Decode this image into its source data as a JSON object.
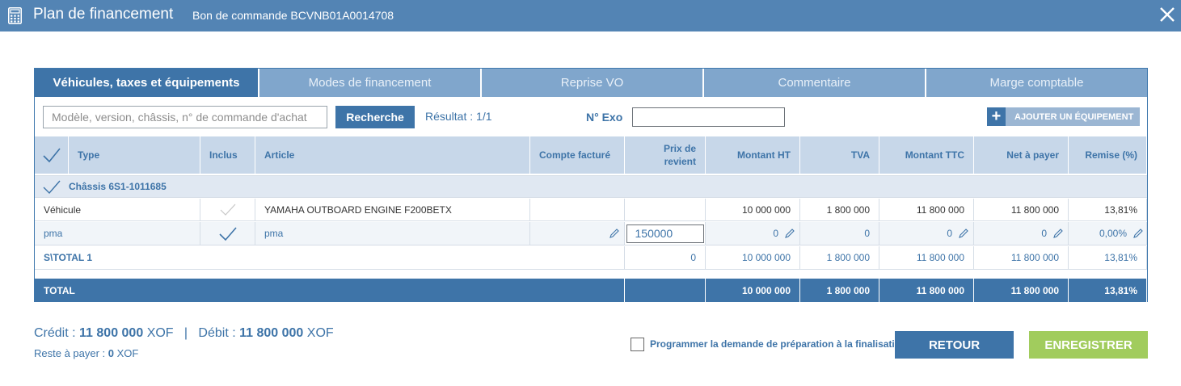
{
  "window": {
    "title": "Plan de financement",
    "subtitle": "Bon de commande BCVNB01A0014708",
    "icon": "calculator-icon",
    "close_icon": "close-icon"
  },
  "tabs": [
    {
      "label": "Véhicules, taxes et équipements",
      "active": true
    },
    {
      "label": "Modes de financement",
      "active": false
    },
    {
      "label": "Reprise VO",
      "active": false
    },
    {
      "label": "Commentaire",
      "active": false
    },
    {
      "label": "Marge comptable",
      "active": false
    }
  ],
  "toolbar": {
    "search_placeholder": "Modèle, version, châssis, n° de commande d'achat",
    "search_value": "",
    "search_button": "Recherche",
    "result_text": "Résultat : 1/1",
    "exo_label": "N° Exo",
    "exo_value": "",
    "add_button": "AJOUTER UN ÉQUIPEMENT",
    "add_icon": "plus-icon"
  },
  "table": {
    "headers": {
      "type": "Type",
      "inclus": "Inclus",
      "article": "Article",
      "compte": "Compte facturé",
      "prix_line1": "Prix de",
      "prix_line2": "revient",
      "ht": "Montant HT",
      "tva": "TVA",
      "ttc": "Montant TTC",
      "net": "Net à payer",
      "remise": "Remise (%)"
    },
    "chassis_label": "Châssis 6S1-1011685",
    "rows": [
      {
        "type": "Véhicule",
        "article": "YAMAHA OUTBOARD ENGINE F200BETX",
        "compte": "",
        "prix": "",
        "ht": "10 000 000",
        "tva": "1 800 000",
        "ttc": "11 800 000",
        "net": "11 800 000",
        "remise": "13,81%"
      },
      {
        "type": "pma",
        "article": "pma",
        "compte": "",
        "prix": "150000",
        "ht": "0",
        "tva": "0",
        "ttc": "0",
        "net": "0",
        "remise": "0,00%"
      }
    ],
    "subtotal": {
      "label": "S\\TOTAL 1",
      "prix": "0",
      "ht": "10 000 000",
      "tva": "1 800 000",
      "ttc": "11 800 000",
      "net": "11 800 000",
      "remise": "13,81%"
    },
    "total": {
      "label": "TOTAL",
      "ht": "10 000 000",
      "tva": "1 800 000",
      "ttc": "11 800 000",
      "net": "11 800 000",
      "remise": "13,81%"
    }
  },
  "footer": {
    "credit_label": "Crédit :",
    "credit_value": "11 800 000",
    "credit_currency": "XOF",
    "separator": "|",
    "debit_label": "Débit :",
    "debit_value": "11 800 000",
    "debit_currency": "XOF",
    "rest_label": "Reste à payer :",
    "rest_value": "0",
    "rest_currency": "XOF",
    "checkbox_label": "Programmer la demande de préparation à la finalisation",
    "checkbox_checked": false,
    "retour_button": "RETOUR",
    "save_button": "ENREGISTRER"
  },
  "colors": {
    "header_bar": "#5384b4",
    "primary": "#3e74a8",
    "tab_inactive": "#80a6cc",
    "save_green": "#a1cc5d"
  }
}
